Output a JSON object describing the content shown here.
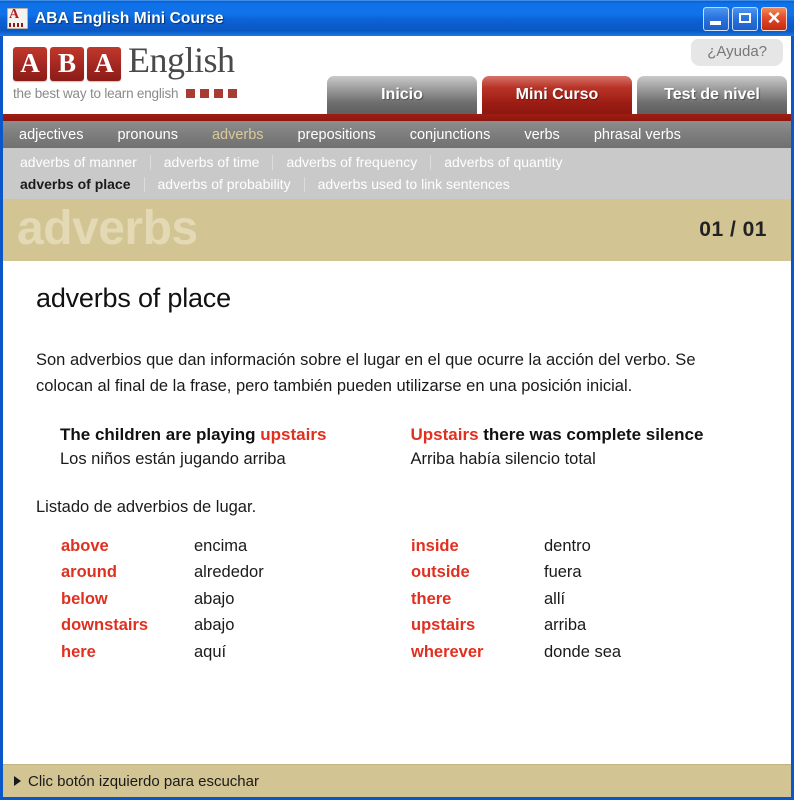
{
  "window": {
    "title": "ABA English Mini Course",
    "icon": "aba-app-icon",
    "controls": {
      "minimize": "minimize-button",
      "maximize": "maximize-button",
      "close": "close-button"
    }
  },
  "header": {
    "logo": {
      "letters": [
        "A",
        "B",
        "A"
      ],
      "word": "English",
      "tagline": "the best way to learn english"
    },
    "help_label": "¿Ayuda?",
    "tabs": [
      {
        "label": "Inicio",
        "active": false
      },
      {
        "label": "Mini Curso",
        "active": true
      },
      {
        "label": "Test de nivel",
        "active": false
      }
    ]
  },
  "nav_primary": [
    {
      "label": "adjectives",
      "active": false
    },
    {
      "label": "pronouns",
      "active": false
    },
    {
      "label": "adverbs",
      "active": true
    },
    {
      "label": "prepositions",
      "active": false
    },
    {
      "label": "conjunctions",
      "active": false
    },
    {
      "label": "verbs",
      "active": false
    },
    {
      "label": "phrasal verbs",
      "active": false
    }
  ],
  "nav_secondary_row1": [
    {
      "label": "adverbs of manner",
      "active": false
    },
    {
      "label": "adverbs of time",
      "active": false
    },
    {
      "label": "adverbs of frequency",
      "active": false
    },
    {
      "label": "adverbs of quantity",
      "active": false
    }
  ],
  "nav_secondary_row2": [
    {
      "label": "adverbs of place",
      "active": true
    },
    {
      "label": "adverbs of probability",
      "active": false
    },
    {
      "label": "adverbs used to link sentences",
      "active": false
    }
  ],
  "banner": {
    "word": "adverbs",
    "page": "01 / 01"
  },
  "lesson": {
    "title": "adverbs of place",
    "intro": "Son adverbios que dan información sobre el lugar en el que ocurre la acción del verbo. Se colocan al final de la frase, pero también pueden utilizarse en una posición inicial.",
    "examples": [
      {
        "en_before": "The children are playing ",
        "en_highlight": "upstairs",
        "en_after": "",
        "es": "Los niños están jugando arriba"
      },
      {
        "en_before": "",
        "en_highlight": "Upstairs",
        "en_after": " there was complete silence",
        "es": "Arriba había silencio total"
      }
    ],
    "list_caption": "Listado de adverbios de lugar.",
    "words_col1": [
      {
        "en": "above",
        "es": "encima"
      },
      {
        "en": "around",
        "es": "alrededor"
      },
      {
        "en": "below",
        "es": "abajo"
      },
      {
        "en": "downstairs",
        "es": "abajo"
      },
      {
        "en": "here",
        "es": "aquí"
      }
    ],
    "words_col2": [
      {
        "en": "inside",
        "es": "dentro"
      },
      {
        "en": "outside",
        "es": "fuera"
      },
      {
        "en": "there",
        "es": "allí"
      },
      {
        "en": "upstairs",
        "es": "arriba"
      },
      {
        "en": "wherever",
        "es": "donde sea"
      }
    ]
  },
  "statusbar": {
    "text": "Clic botón izquierdo para escuchar"
  },
  "colors": {
    "titlebar_blue": "#1072e8",
    "brand_red": "#9d1d14",
    "accent_khaki": "#d2c493",
    "word_red": "#e03020",
    "nav_gray": "#7d7d7d"
  }
}
